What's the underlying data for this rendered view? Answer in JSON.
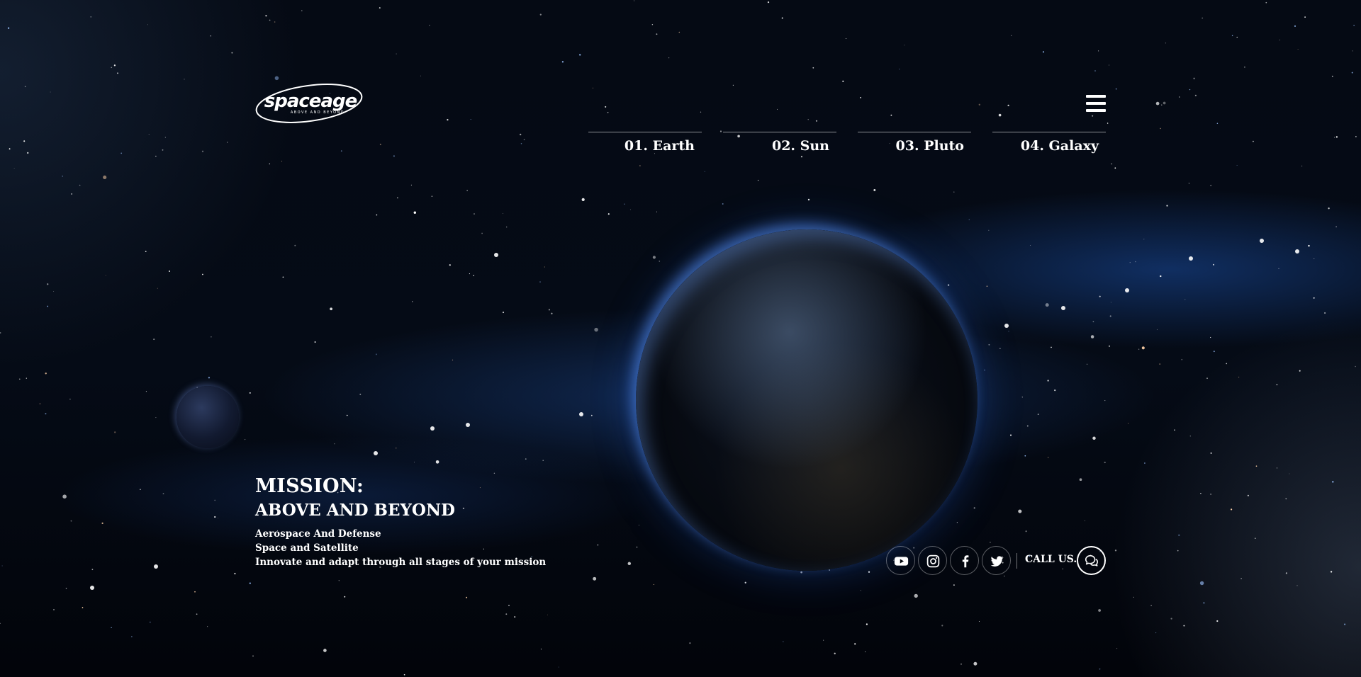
{
  "brand": {
    "logo_text": "spaceage",
    "tagline": "ABOVE AND BEYOND"
  },
  "nav": {
    "menu_icon": "hamburger-menu-icon",
    "tabs": [
      {
        "label": "01. Earth"
      },
      {
        "label": "02. Sun"
      },
      {
        "label": "03. Pluto"
      },
      {
        "label": "04. Galaxy"
      }
    ]
  },
  "hero": {
    "heading": "MISSION:",
    "subheading": "ABOVE AND BEYOND",
    "lines": [
      "Aerospace And Defense",
      "Space and Satellite",
      "Innovate and adapt through all stages of your mission"
    ]
  },
  "social": {
    "icons": [
      "youtube-icon",
      "instagram-icon",
      "facebook-icon",
      "twitter-icon"
    ],
    "call_label": "CALL US.",
    "chat_icon": "chat-bubbles-icon"
  },
  "colors": {
    "background": "#03060d",
    "nebula_blue": "#2a6cd6",
    "text": "#ffffff"
  }
}
